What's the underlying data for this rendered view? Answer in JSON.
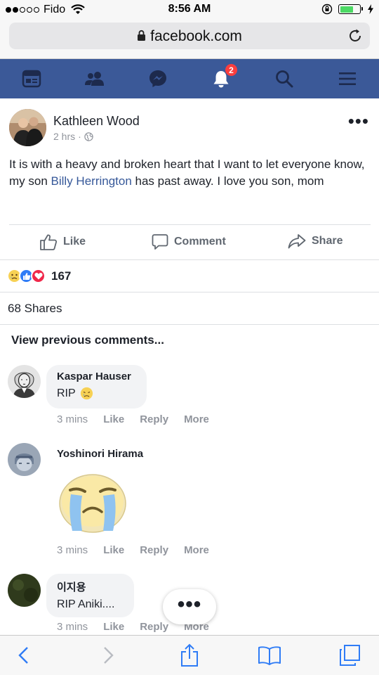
{
  "status_bar": {
    "carrier": "Fido",
    "time": "8:56 AM"
  },
  "browser": {
    "url": "facebook.com"
  },
  "fb_nav": {
    "notification_count": "2",
    "icons": [
      "news-feed-icon",
      "friends-icon",
      "messenger-icon",
      "notifications-icon",
      "search-icon",
      "menu-icon"
    ]
  },
  "post": {
    "author": "Kathleen Wood",
    "time": "2 hrs",
    "separator": "·",
    "text_before": "It is with a heavy and broken heart that I want to let everyone know, my son ",
    "mention": "Billy Herrington",
    "text_after": " has past away. I love you son, mom",
    "actions": {
      "like": "Like",
      "comment": "Comment",
      "share": "Share"
    },
    "reaction_count": "167",
    "shares": "68 Shares",
    "view_previous": "View previous comments..."
  },
  "comments": [
    {
      "name": "Kaspar Hauser",
      "text": "RIP",
      "time": "3 mins",
      "like": "Like",
      "reply": "Reply",
      "more": "More"
    },
    {
      "name": "Yoshinori Hirama",
      "text": "",
      "time": "3 mins",
      "like": "Like",
      "reply": "Reply",
      "more": "More"
    },
    {
      "name": "이지용",
      "text": "RIP Aniki....",
      "time": "3 mins",
      "like": "Like",
      "reply": "Reply",
      "more": "More"
    }
  ],
  "colors": {
    "fb_blue": "#3b5998",
    "link": "#365899",
    "meta_gray": "#90949c",
    "badge_red": "#fa3e3e",
    "ios_blue": "#2f7cf6"
  }
}
